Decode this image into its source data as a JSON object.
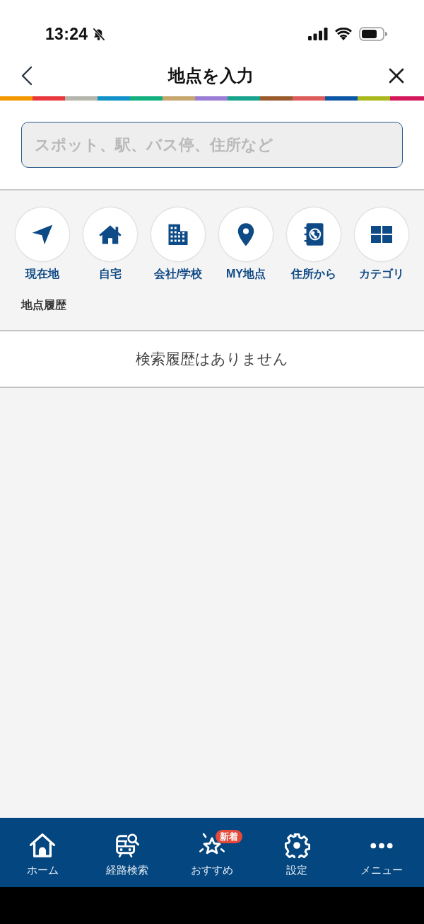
{
  "status_bar": {
    "time": "13:24",
    "silent": true
  },
  "header": {
    "title": "地点を入力"
  },
  "search": {
    "placeholder": "スポット、駅、バス停、住所など"
  },
  "shortcuts": [
    {
      "label": "現在地",
      "kind": "location"
    },
    {
      "label": "自宅",
      "kind": "home"
    },
    {
      "label": "会社/学校",
      "kind": "office"
    },
    {
      "label": "MY地点",
      "kind": "pin"
    },
    {
      "label": "住所から",
      "kind": "address"
    },
    {
      "label": "カテゴリ",
      "kind": "category"
    }
  ],
  "history": {
    "title": "地点履歴",
    "empty_message": "検索履歴はありません"
  },
  "tab_bar": [
    {
      "label": "ホーム",
      "kind": "home"
    },
    {
      "label": "経路検索",
      "kind": "route"
    },
    {
      "label": "おすすめ",
      "kind": "recommend",
      "badge": "新着"
    },
    {
      "label": "設定",
      "kind": "settings"
    },
    {
      "label": "メニュー",
      "kind": "menu"
    }
  ]
}
